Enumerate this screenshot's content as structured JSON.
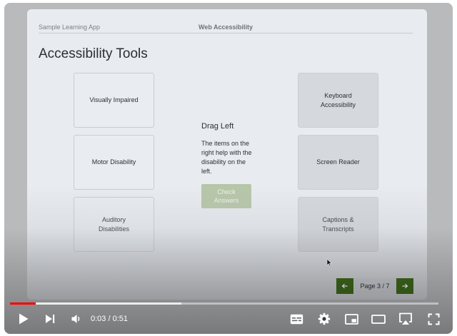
{
  "slide": {
    "app_name": "Sample Learning App",
    "course_name": "Web Accessibility",
    "title": "Accessibility Tools",
    "targets": [
      {
        "label": "Visually Impaired"
      },
      {
        "label": "Motor Disability"
      },
      {
        "label": "Auditory\nDisabilities"
      }
    ],
    "drag_items": [
      {
        "label": "Keyboard\nAccessibility"
      },
      {
        "label": "Screen Reader"
      },
      {
        "label": "Captions &\nTranscripts"
      }
    ],
    "instructions_title": "Drag Left",
    "instructions_text": "The items on the right help with the disability on the left.",
    "check_button_label": "Check\nAnswers",
    "pager": {
      "label": "Page 3 / 7",
      "prev_icon": "arrow-left-icon",
      "next_icon": "arrow-right-icon"
    },
    "colors": {
      "accent_green": "#3f6a1d",
      "disabled_button": "#b6c6a8",
      "slide_background": "#e8ebf0"
    }
  },
  "player": {
    "time_display": "0:03 / 0:51",
    "progress_fraction": 0.06,
    "buffer_fraction": 0.4,
    "progress_color": "#ff0000",
    "icons": [
      "play-icon",
      "next-icon",
      "volume-icon",
      "subtitles-icon",
      "settings-icon",
      "miniplayer-icon",
      "theater-icon",
      "airplay-icon",
      "fullscreen-icon"
    ]
  }
}
